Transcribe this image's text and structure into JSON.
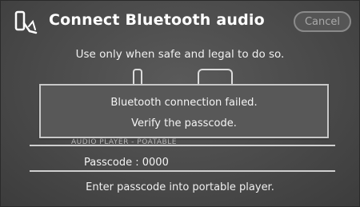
{
  "header": {
    "title": "Connect Bluetooth audio",
    "cancel_label": "Cancel"
  },
  "notice": "Use only when safe and legal to do so.",
  "dialog": {
    "line1": "Bluetooth connection failed.",
    "line2": "Verify the passcode."
  },
  "device_name_fragment": "AUDIO PLAYER - POATABLE",
  "passcode_label": "Passcode : 0000",
  "instruction": "Enter passcode into portable player."
}
